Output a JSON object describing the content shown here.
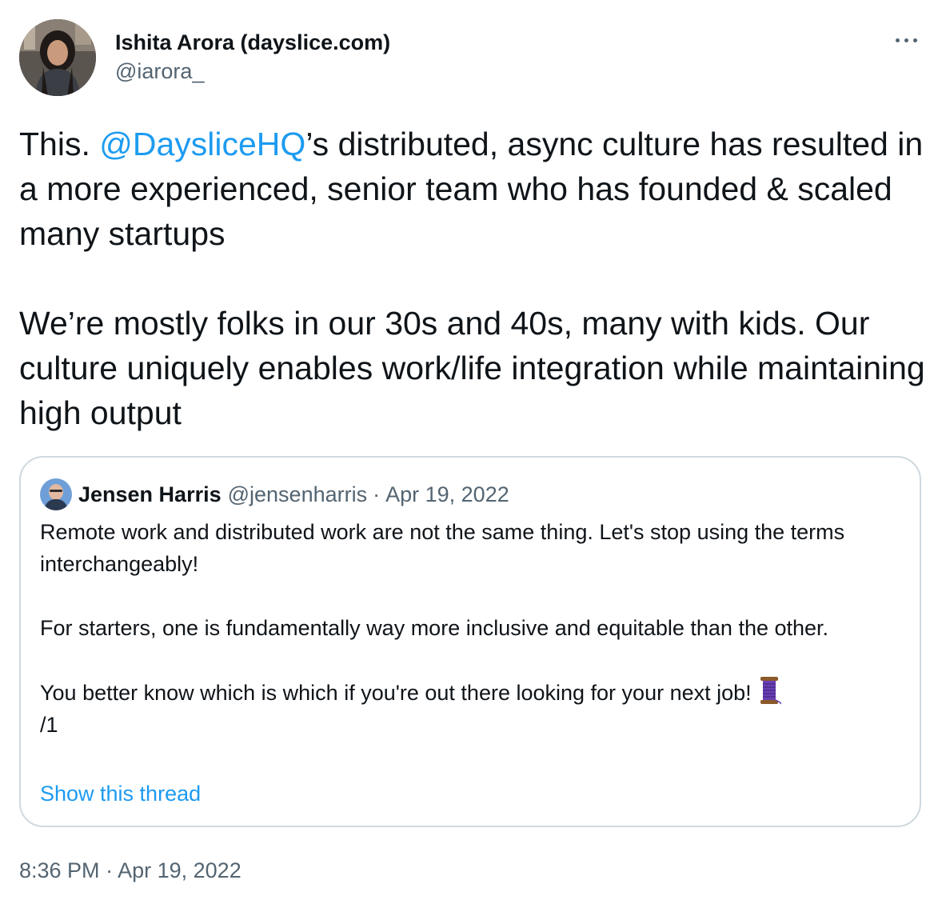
{
  "author": {
    "display_name": "Ishita Arora (dayslice.com)",
    "handle": "@iarora_",
    "avatar": "profile-photo"
  },
  "more_icon": "more-horizontal-icon",
  "tweet": {
    "prefix": "This. ",
    "mention": "@DaysliceHQ",
    "rest": "’s distributed, async culture has resulted in a more experienced, senior team who has founded & scaled many startups\n\nWe’re mostly folks in our 30s and 40s, many with kids. Our culture uniquely enables work/life integration while maintaining high output"
  },
  "quoted_tweet": {
    "author_name": "Jensen Harris",
    "author_handle": "@jensenharris",
    "separator": "·",
    "date": "Apr 19, 2022",
    "text_part1": "Remote work and distributed work are not the same thing. Let's stop using the terms interchangeably!\n\nFor starters, one is fundamentally way more inclusive and equitable than the other.\n\nYou better know which is which if you're out there looking for your next job! ",
    "thread_emoji": "thread-spool-icon",
    "text_part2": "\n/1",
    "show_thread": "Show this thread"
  },
  "meta": {
    "time": "8:36 PM",
    "separator": "·",
    "date": "Apr 19, 2022"
  },
  "colors": {
    "link": "#1d9bf0",
    "secondary": "#536471",
    "border": "#cfd9de",
    "text": "#0f1419"
  }
}
